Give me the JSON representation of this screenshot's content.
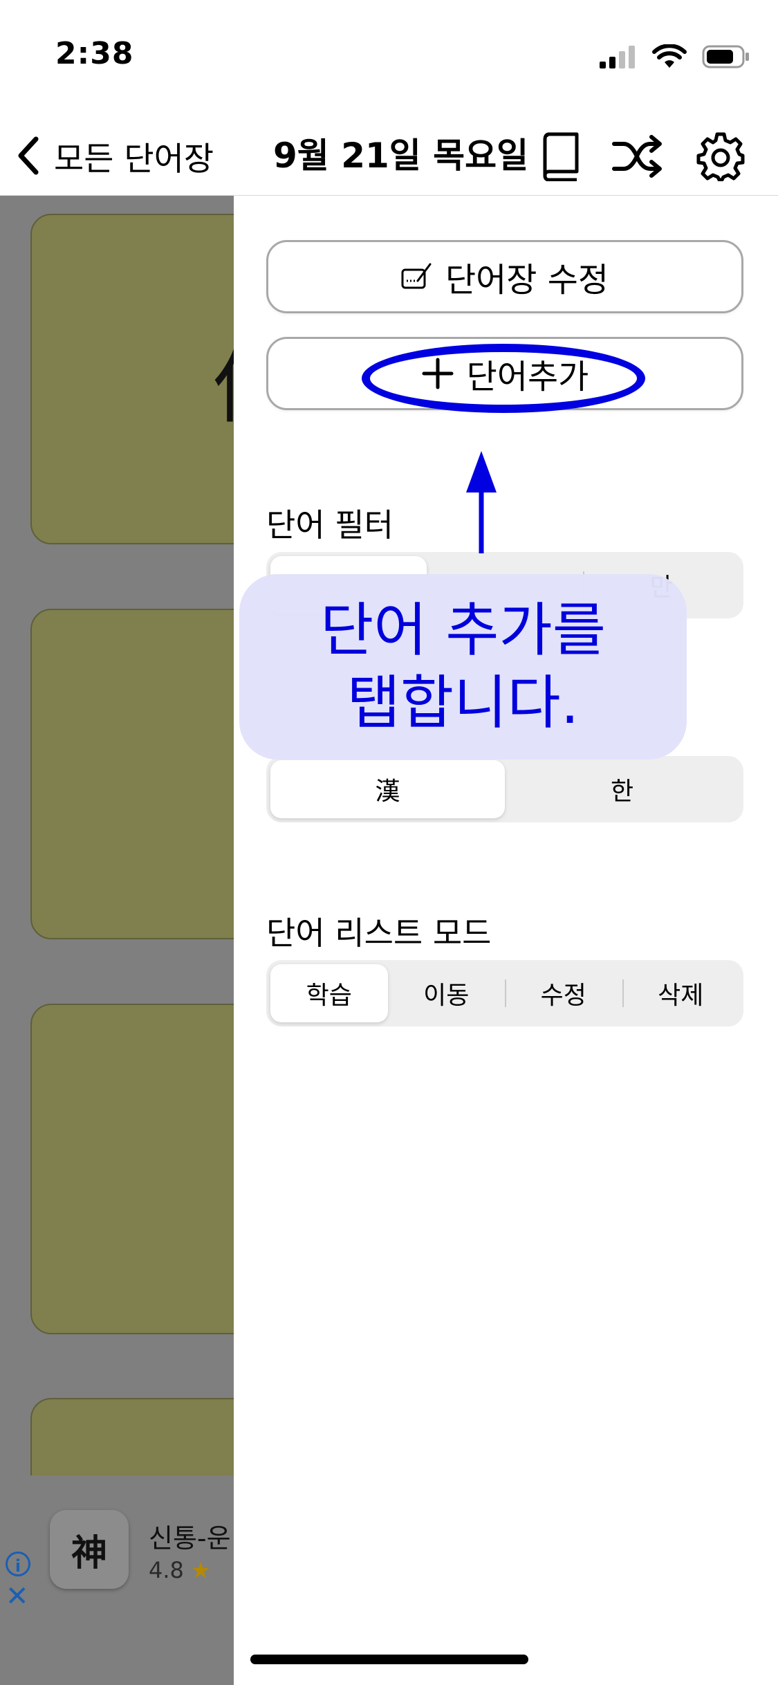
{
  "status_bar": {
    "time": "2:38"
  },
  "nav": {
    "back_label": "모든 단어장",
    "title": "9월 21일 목요일"
  },
  "background": {
    "card_glyph": "低",
    "ad": {
      "app_name": "신통-운",
      "rating": "4.8",
      "info": "i",
      "close": "✕"
    }
  },
  "panel": {
    "edit_wordbook_label": "단어장 수정",
    "add_word_label": "단어추가",
    "word_filter": {
      "label": "단어 필터",
      "options": [
        "",
        "",
        "만"
      ]
    },
    "script_toggle": {
      "options": [
        "漢",
        "한"
      ],
      "selected": 0
    },
    "list_mode": {
      "label": "단어 리스트 모드",
      "options": [
        "학습",
        "이동",
        "수정",
        "삭제"
      ],
      "selected": 0
    }
  },
  "annotation": {
    "callout_line1": "단어 추가를",
    "callout_line2": "탭합니다."
  },
  "colors": {
    "annotation": "#0000e0",
    "card": "#807f4e",
    "dim": "#7f7f7f"
  }
}
